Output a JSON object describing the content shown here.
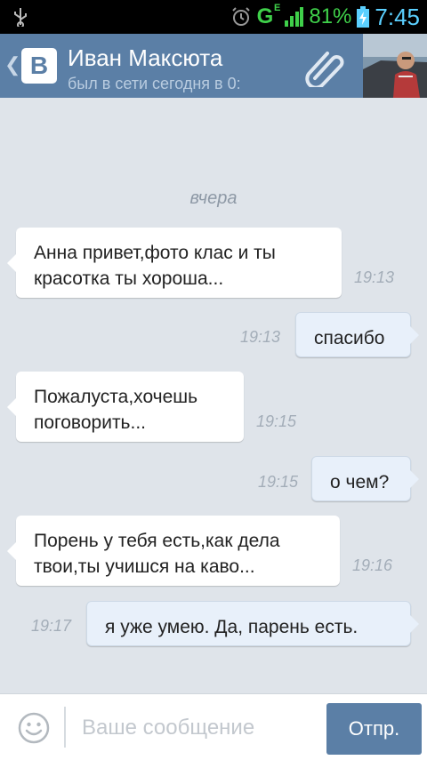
{
  "status_bar": {
    "network": "G",
    "network_sup": "E",
    "battery_pct": "81%",
    "time": "7:45"
  },
  "header": {
    "title": "Иван Максюта",
    "subtitle": "был в сети сегодня в 0:",
    "logo_letter": "В"
  },
  "chat": {
    "date_separator": "вчера",
    "messages": [
      {
        "direction": "incoming",
        "text": "Анна привет,фото клас и ты красотка ты хороша...",
        "time": "19:13"
      },
      {
        "direction": "outgoing",
        "text": "спасибо",
        "time": "19:13"
      },
      {
        "direction": "incoming",
        "text": "Пожалуста,хочешь поговорить...",
        "time": "19:15"
      },
      {
        "direction": "outgoing",
        "text": "о чем?",
        "time": "19:15"
      },
      {
        "direction": "incoming",
        "text": "Порень у тебя есть,как дела твои,ты учишся на каво...",
        "time": "19:16"
      },
      {
        "direction": "outgoing",
        "text": "я уже умею. Да, парень есть.",
        "time": "19:17"
      }
    ]
  },
  "composer": {
    "placeholder": "Ваше сообщение",
    "send_label": "Отпр."
  },
  "colors": {
    "header": "#5b7fa6",
    "chat_background": "#dfe4ea",
    "outgoing_bubble": "#e8f0fa"
  }
}
